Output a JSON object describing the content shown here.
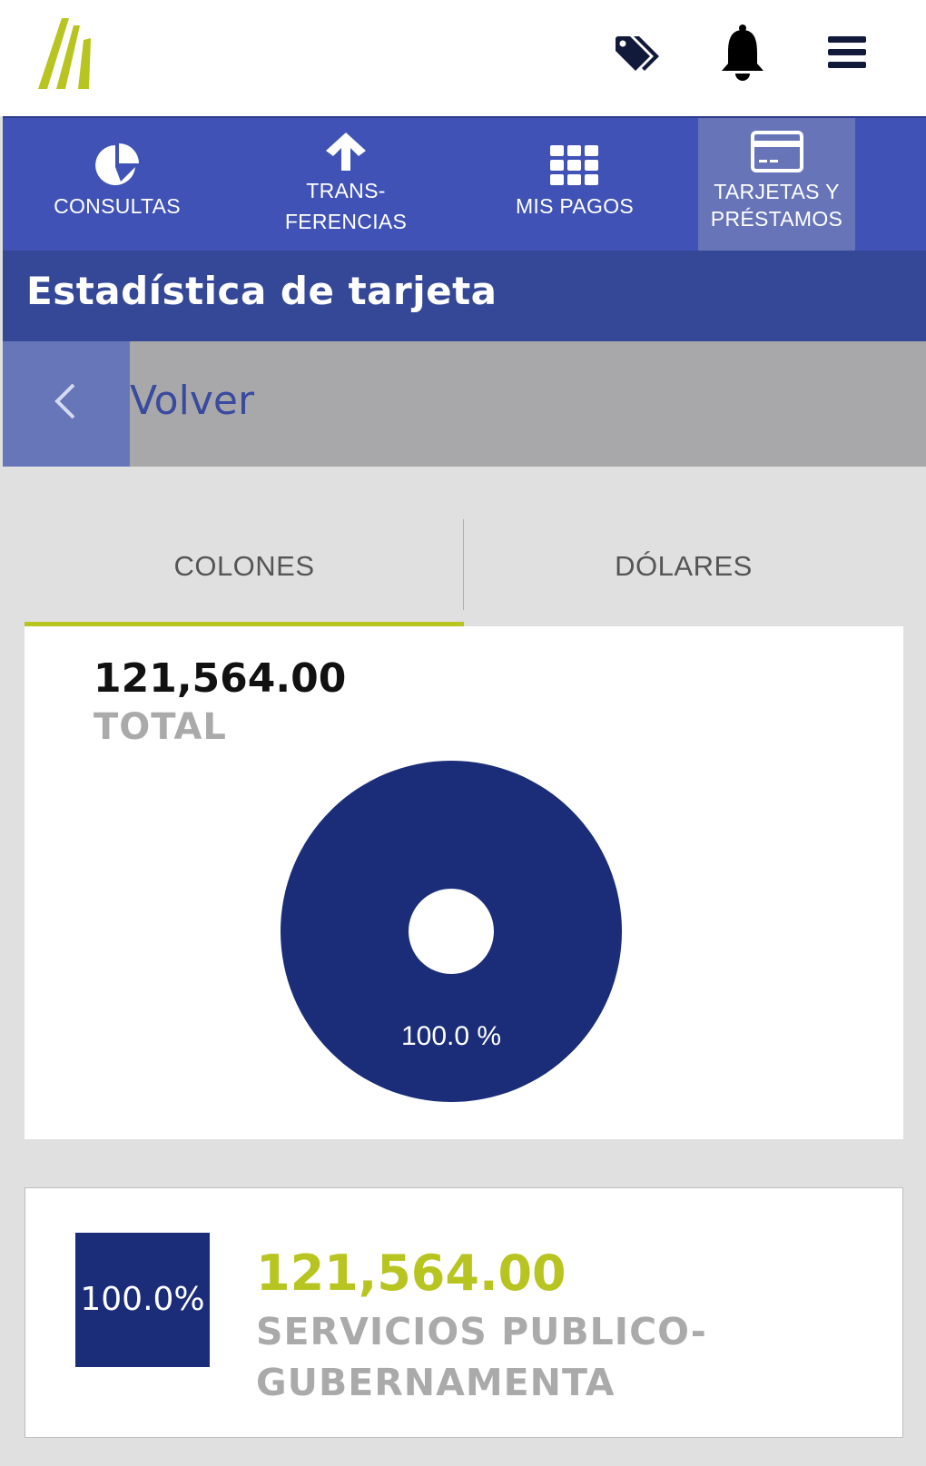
{
  "colors": {
    "brand_green": "#b8c520",
    "nav_blue": "#4052b5",
    "title_blue": "#354897",
    "chart_navy": "#1b2d78"
  },
  "header": {
    "icons": [
      "tags-icon",
      "bell-icon",
      "menu-icon"
    ]
  },
  "nav": {
    "items": [
      {
        "icon": "pie-chart-icon",
        "label": "CONSULTAS"
      },
      {
        "icon": "arrow-up-icon",
        "label_line1": "TRANS-",
        "label_line2": "FERENCIAS"
      },
      {
        "icon": "grid-icon",
        "label": "MIS PAGOS"
      },
      {
        "icon": "credit-card-icon",
        "label_line1": "TARJETAS Y",
        "label_line2": "PRÉSTAMOS",
        "active": true
      }
    ]
  },
  "page": {
    "title": "Estadística de tarjeta",
    "back_label": "Volver"
  },
  "tabs": {
    "colones": "COLONES",
    "dolares": "DÓLARES",
    "selected": "COLONES"
  },
  "summary": {
    "total_value": "121,564.00",
    "total_label": "TOTAL"
  },
  "chart_data": {
    "type": "pie",
    "categories": [
      "SERVICIOS PUBLICO-GUBERNAMENTA"
    ],
    "values": [
      121564.0
    ],
    "slice_labels": [
      "100.0 %"
    ],
    "colors": [
      "#1b2d78"
    ],
    "donut": true
  },
  "legend": {
    "items": [
      {
        "percent": "100.0%",
        "amount": "121,564.00",
        "name": "SERVICIOS PUBLICO-GUBERNAMENTA"
      }
    ]
  }
}
